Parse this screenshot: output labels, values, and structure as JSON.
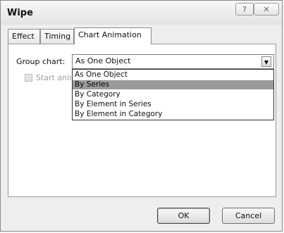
{
  "window": {
    "title": "Wipe"
  },
  "titlebar_buttons": {
    "help": "?",
    "close": "✕"
  },
  "tabs": [
    {
      "label": "Effect",
      "active": false
    },
    {
      "label": "Timing",
      "active": false
    },
    {
      "label": "Chart Animation",
      "active": true
    }
  ],
  "group_chart": {
    "label": "Group chart:",
    "value": "As One Object",
    "options": [
      "As One Object",
      "By Series",
      "By Category",
      "By Element in Series",
      "By Element in Category"
    ],
    "highlighted_option": "By Series"
  },
  "start_animation": {
    "label": "Start animating background"
  },
  "buttons": {
    "ok": "OK",
    "cancel": "Cancel"
  },
  "colors": {
    "highlight": "#9a9a9a"
  }
}
